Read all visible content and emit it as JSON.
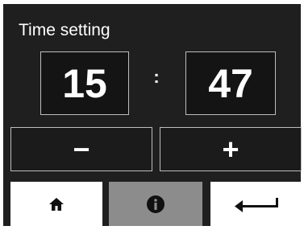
{
  "header": {
    "title": "Time setting"
  },
  "time": {
    "hours": "15",
    "separator": ":",
    "minutes": "47"
  },
  "controls": {
    "decrement_label": "−",
    "increment_label": "+"
  },
  "footer": {
    "home_icon": "home-icon",
    "info_icon": "info-icon",
    "back_icon": "return-arrow-icon"
  },
  "colors": {
    "background": "#1f1f1f",
    "text": "#ffffff",
    "button_light": "#ffffff",
    "button_disabled": "#8c8c8c"
  }
}
